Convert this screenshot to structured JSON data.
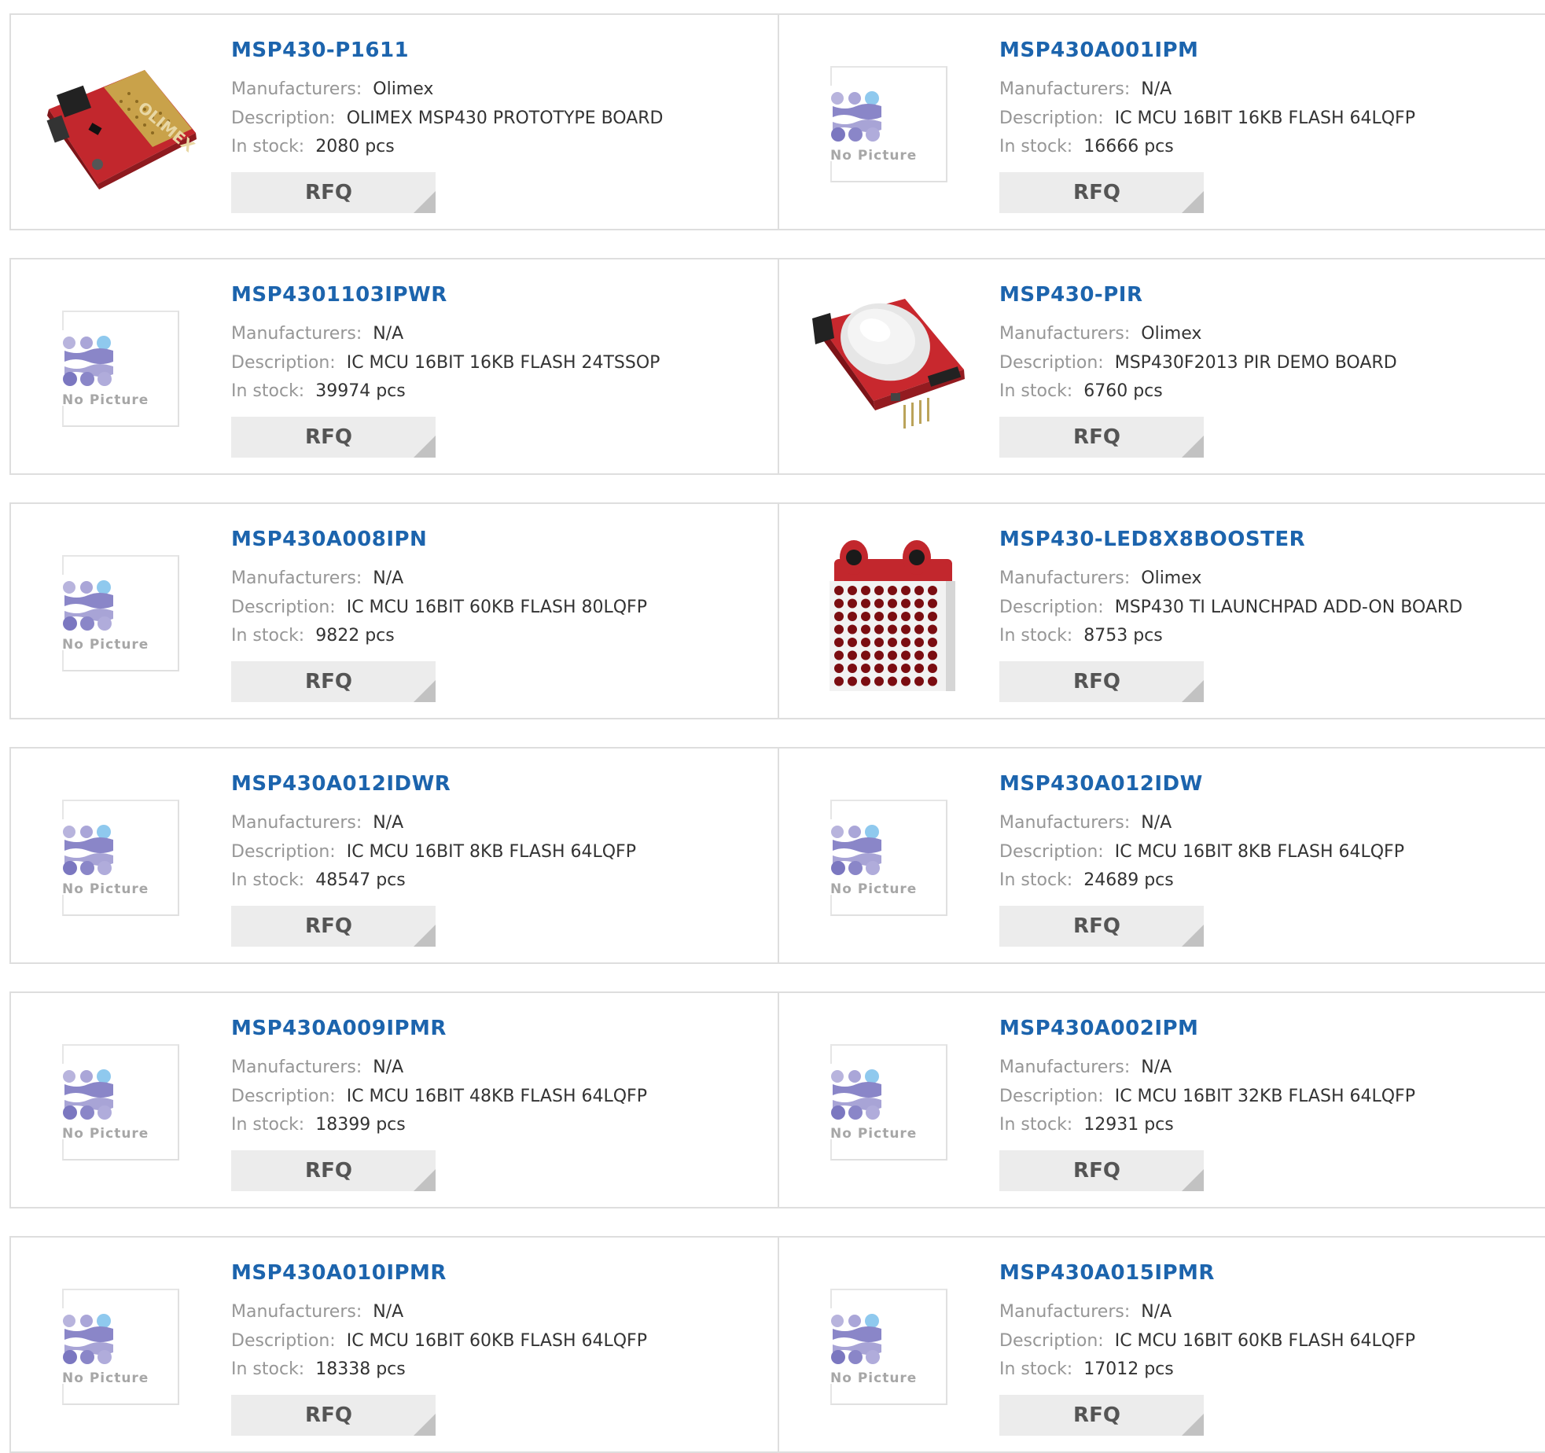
{
  "labels": {
    "manufacturers": "Manufacturers:",
    "description": "Description:",
    "stock": "In stock:",
    "rfq": "RFQ",
    "no_picture": "No Picture"
  },
  "products": [
    {
      "part": "MSP430-P1611",
      "manufacturer": "Olimex",
      "description": "OLIMEX MSP430 PROTOTYPE BOARD",
      "stock": "2080 pcs",
      "image": "board-photo"
    },
    {
      "part": "MSP430A001IPM",
      "manufacturer": "N/A",
      "description": "IC MCU 16BIT 16KB FLASH 64LQFP",
      "stock": "16666 pcs",
      "image": "no-picture"
    },
    {
      "part": "MSP4301103IPWR",
      "manufacturer": "N/A",
      "description": "IC MCU 16BIT 16KB FLASH 24TSSOP",
      "stock": "39974 pcs",
      "image": "no-picture"
    },
    {
      "part": "MSP430-PIR",
      "manufacturer": "Olimex",
      "description": "MSP430F2013 PIR DEMO BOARD",
      "stock": "6760 pcs",
      "image": "pir-photo"
    },
    {
      "part": "MSP430A008IPN",
      "manufacturer": "N/A",
      "description": "IC MCU 16BIT 60KB FLASH 80LQFP",
      "stock": "9822 pcs",
      "image": "no-picture"
    },
    {
      "part": "MSP430-LED8X8BOOSTER",
      "manufacturer": "Olimex",
      "description": "MSP430 TI LAUNCHPAD ADD-ON BOARD",
      "stock": "8753 pcs",
      "image": "led-matrix-photo"
    },
    {
      "part": "MSP430A012IDWR",
      "manufacturer": "N/A",
      "description": "IC MCU 16BIT 8KB FLASH 64LQFP",
      "stock": "48547 pcs",
      "image": "no-picture"
    },
    {
      "part": "MSP430A012IDW",
      "manufacturer": "N/A",
      "description": "IC MCU 16BIT 8KB FLASH 64LQFP",
      "stock": "24689 pcs",
      "image": "no-picture"
    },
    {
      "part": "MSP430A009IPMR",
      "manufacturer": "N/A",
      "description": "IC MCU 16BIT 48KB FLASH 64LQFP",
      "stock": "18399 pcs",
      "image": "no-picture"
    },
    {
      "part": "MSP430A002IPM",
      "manufacturer": "N/A",
      "description": "IC MCU 16BIT 32KB FLASH 64LQFP",
      "stock": "12931 pcs",
      "image": "no-picture"
    },
    {
      "part": "MSP430A010IPMR",
      "manufacturer": "N/A",
      "description": "IC MCU 16BIT 60KB FLASH 64LQFP",
      "stock": "18338 pcs",
      "image": "no-picture"
    },
    {
      "part": "MSP430A015IPMR",
      "manufacturer": "N/A",
      "description": "IC MCU 16BIT 60KB FLASH 64LQFP",
      "stock": "17012 pcs",
      "image": "no-picture"
    }
  ],
  "colors": {
    "title": "#1c64ad",
    "label": "#969696",
    "value": "#333333",
    "border": "#dedede",
    "rfq_bg": "#ececec",
    "logo_blue": "#8fc9ee",
    "logo_purple": "#8a86c8"
  }
}
